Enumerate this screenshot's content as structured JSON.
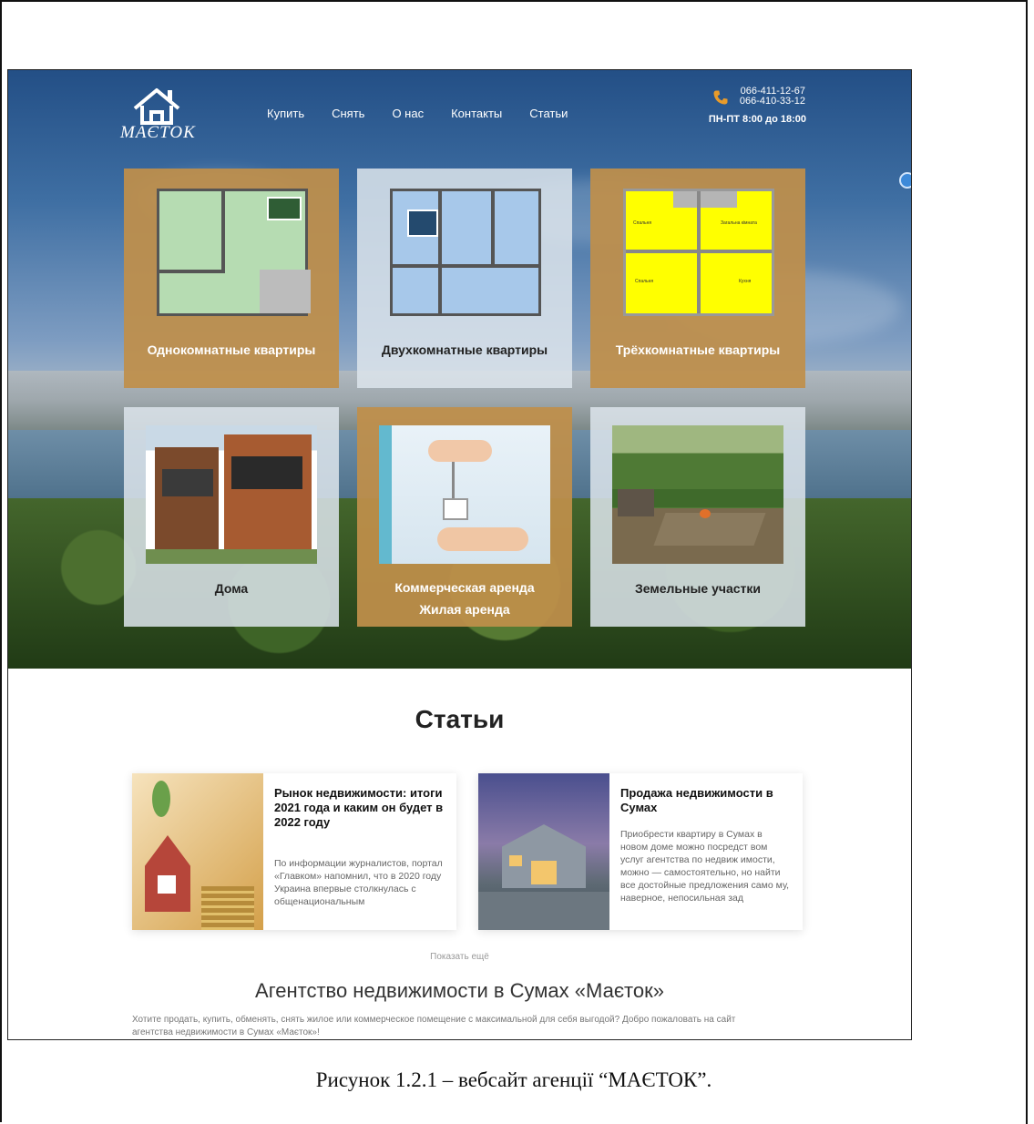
{
  "site": {
    "logo_text": "MAЄTOK",
    "nav": [
      "Купить",
      "Снять",
      "О нас",
      "Контакты",
      "Статьи"
    ],
    "phones": [
      "066-411-12-67",
      "066-410-33-12"
    ],
    "hours": "ПН-ПТ 8:00 до 18:00"
  },
  "tiles": [
    {
      "label": "Однокомнатные квартиры"
    },
    {
      "label": "Двухкомнатные квартиры"
    },
    {
      "label": "Трёхкомнатные квартиры"
    },
    {
      "label": "Дома"
    },
    {
      "label_line1": "Коммерческая аренда",
      "label_line2": "Жилая аренда"
    },
    {
      "label": "Земельные участки"
    }
  ],
  "plan_labels": {
    "three_room_1": "Спальня",
    "three_room_2": "Загальна кімната",
    "three_room_3": "Спальня",
    "three_room_4": "Кухня"
  },
  "articles": {
    "title": "Статьи",
    "items": [
      {
        "title": "Рынок недвижимости: итоги 2021 года и каким он будет в 2022 году",
        "text": "По информации журналистов, портал «Главком» напомнил, что в 2020 году Украина впервые столкнулась с общенациональным"
      },
      {
        "title": "Продажа недвижимости в Сумах",
        "text": "Приобрести квартиру в Сумах в новом доме можно посредст вом услуг агентства по недвиж имости, можно — самостоятельно, но найти все достойные предложения само му, наверное, непосильная зад"
      }
    ],
    "more": "Показать ещё"
  },
  "agency": {
    "title": "Агентство недвижимости в Сумах «Маєток»",
    "text": "Хотите продать, купить, обменять, снять жилое или коммерческое помещение с максимальной для себя выгодой? Добро пожаловать на сайт агентства недвижимости в Сумах «Маєток»!"
  },
  "caption": "Рисунок 1.2.1 – вебсайт агенції “МАЄТОК”.",
  "colors": {
    "gold": "#c08f4a",
    "light_tile": "#dce4eb",
    "plan_green": "#b6dcb2",
    "plan_blue": "#a7c8ea",
    "plan_yellow": "#ffff00"
  }
}
